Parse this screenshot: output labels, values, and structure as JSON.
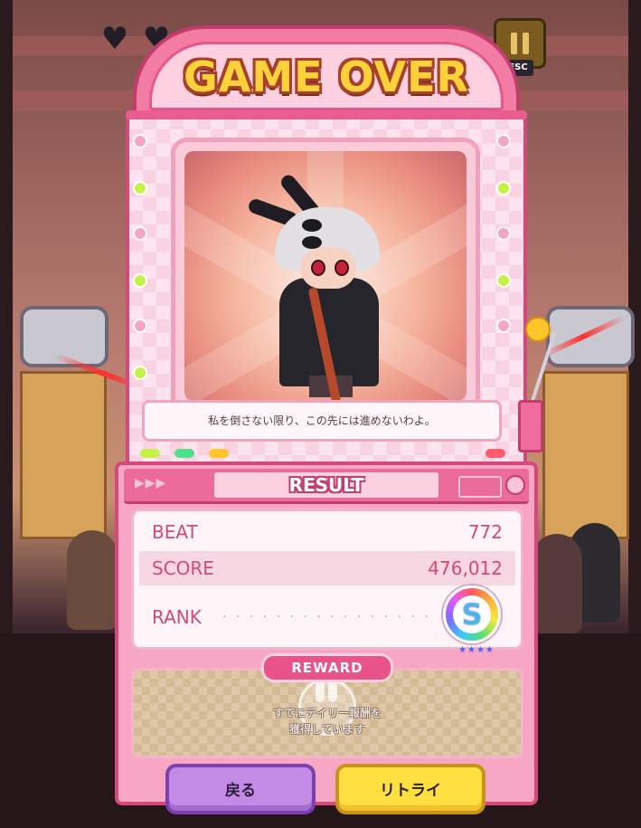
{
  "hud": {
    "lives": [
      "heart-icon",
      "heart-icon"
    ],
    "pause_icon": "pause-icon",
    "esc_label": "ESC"
  },
  "title": "GAME OVER",
  "dialogue": "私を倒さない限り、この先には進めないわよ。",
  "result": {
    "header": "RESULT",
    "beat_label": "BEAT",
    "beat_value": "772",
    "score_label": "SCORE",
    "score_value": "476,012",
    "rank_label": "RANK",
    "rank_value": "S"
  },
  "reward": {
    "header": "REWARD",
    "message_line1": "すでにデイリー報酬を",
    "message_line2": "獲得しています"
  },
  "buttons": {
    "back": "戻る",
    "retry": "リトライ"
  },
  "colors": {
    "accent_pink": "#ec6c99",
    "title_yellow": "#ffd23a",
    "back_button": "#c38be6",
    "retry_button": "#ffe040"
  }
}
